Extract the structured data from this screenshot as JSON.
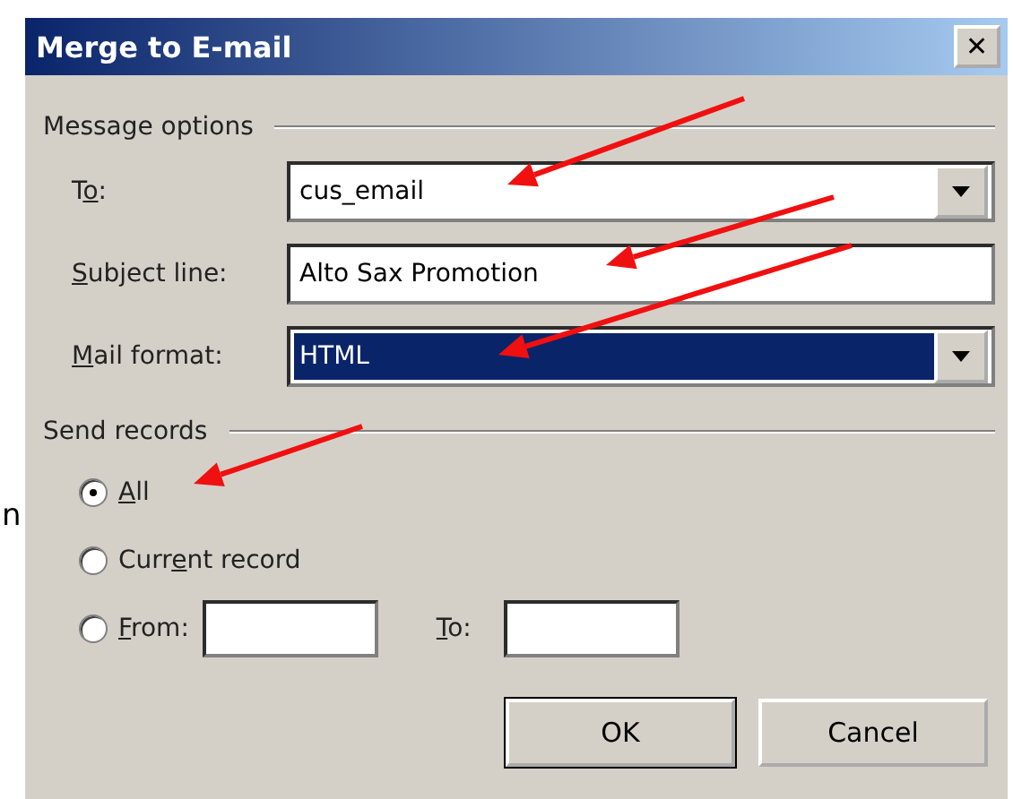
{
  "background_text": "n",
  "window": {
    "title": "Merge to E-mail",
    "close": "✕"
  },
  "message_options": {
    "heading": "Message options",
    "fields": [
      {
        "kind": "combo",
        "before": "T",
        "key": "o",
        "after": ":",
        "value": "cus_email",
        "highlighted": false
      },
      {
        "kind": "text",
        "key": "S",
        "after": "ubject line:",
        "value": "Alto Sax Promotion",
        "highlighted": false
      },
      {
        "kind": "combo",
        "key": "M",
        "after": "ail format:",
        "value": "HTML",
        "highlighted": true
      }
    ]
  },
  "send_records": {
    "heading": "Send records",
    "options": [
      {
        "kind": "plain",
        "key": "A",
        "after": "ll",
        "selected": true
      },
      {
        "kind": "plain",
        "before": "Curr",
        "key": "e",
        "after": "nt record",
        "selected": false
      },
      {
        "kind": "range",
        "key": "F",
        "after": "rom:",
        "selected": false,
        "to": {
          "key": "T",
          "after": "o:"
        }
      }
    ]
  },
  "buttons": [
    {
      "label": "OK",
      "default": true
    },
    {
      "label": "Cancel",
      "default": false
    }
  ],
  "annotations": [
    {
      "kind": "arrow"
    },
    {
      "kind": "arrow"
    },
    {
      "kind": "arrow"
    },
    {
      "kind": "arrow"
    }
  ]
}
